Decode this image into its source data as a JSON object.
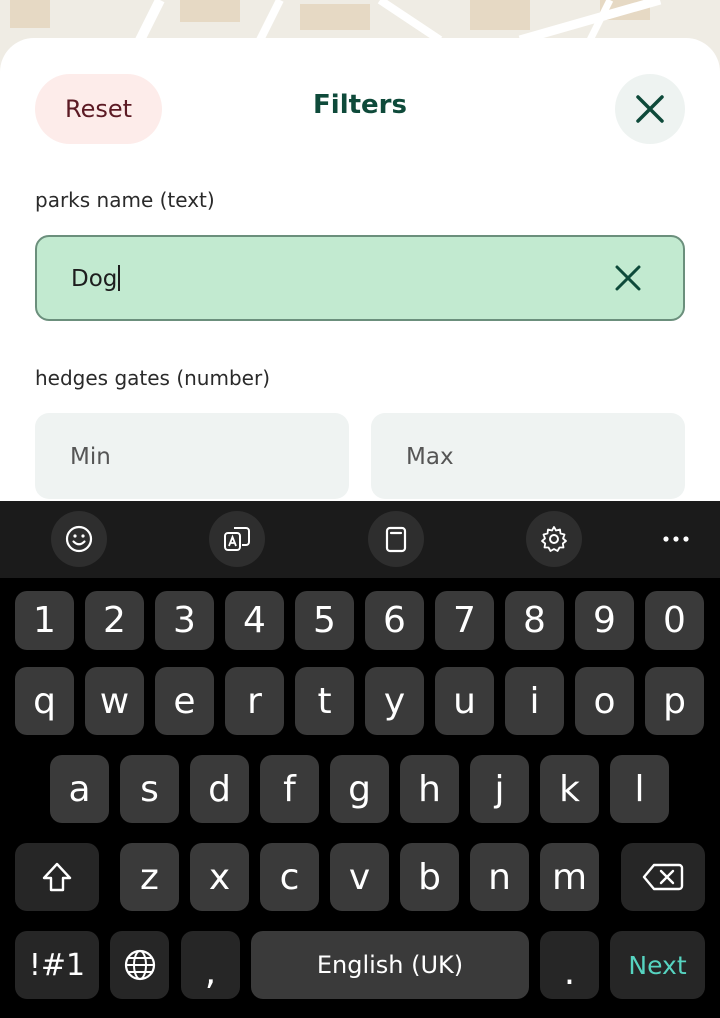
{
  "header": {
    "reset_label": "Reset",
    "title": "Filters",
    "close_icon": "close-icon"
  },
  "fields": {
    "parks_name": {
      "label": "parks name (text)",
      "value": "Dog"
    },
    "hedges_gates": {
      "label": "hedges gates (number)",
      "min_placeholder": "Min",
      "max_placeholder": "Max"
    }
  },
  "keyboard": {
    "toolbar": [
      "emoji-icon",
      "translate-icon",
      "clipboard-icon",
      "settings-icon",
      "more-icon"
    ],
    "row_numbers": [
      "1",
      "2",
      "3",
      "4",
      "5",
      "6",
      "7",
      "8",
      "9",
      "0"
    ],
    "row_top": [
      "q",
      "w",
      "e",
      "r",
      "t",
      "y",
      "u",
      "i",
      "o",
      "p"
    ],
    "row_middle": [
      "a",
      "s",
      "d",
      "f",
      "g",
      "h",
      "j",
      "k",
      "l"
    ],
    "row_bottom": [
      "z",
      "x",
      "c",
      "v",
      "b",
      "n",
      "m"
    ],
    "symbols_label": "!#1",
    "comma_label": ",",
    "space_label": "English (UK)",
    "period_label": ".",
    "next_label": "Next"
  },
  "colors": {
    "accent": "#0e4a3a",
    "field_active": "#c2ead0",
    "reset_bg": "#fdecea",
    "next_text": "#56d3c0"
  }
}
